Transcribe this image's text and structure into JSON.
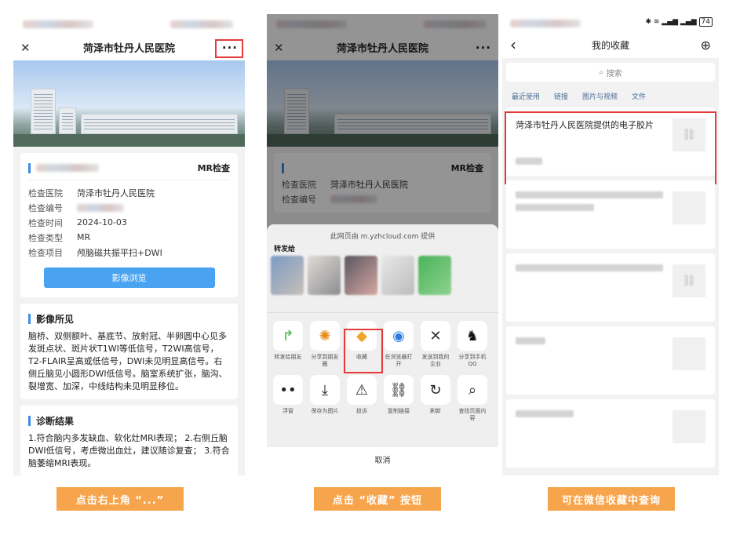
{
  "phone1": {
    "nav_close": "✕",
    "title": "菏泽市牡丹人民医院",
    "more": "···",
    "card_right": "MR检查",
    "rows": [
      {
        "k": "检查医院",
        "v": "菏泽市牡丹人民医院"
      },
      {
        "k": "检查编号",
        "v": ""
      },
      {
        "k": "检查时间",
        "v": "2024-10-03"
      },
      {
        "k": "检查类型",
        "v": "MR"
      },
      {
        "k": "检查项目",
        "v": "颅脑磁共振平扫+DWI"
      }
    ],
    "image_button": "影像浏览",
    "findings_title": "影像所见",
    "findings": "脑桥、双侧额叶、基底节、放射冠、半卵圆中心见多发斑点状、斑片状T1WI等低信号，T2WI高信号，T2-FLAIR呈高或低信号，DWI未见明显高信号。右侧丘脑见小圆形DWI低信号。脑室系统扩张，脑沟、裂增宽、加深，中线结构未见明显移位。",
    "diagnosis_title": "诊断结果",
    "diagnosis": "1.符合脑内多发缺血、软化灶MRI表现； 2.右侧丘脑DWI低信号，考虑微出血灶，建议随诊复查； 3.符合脑萎缩MRI表现。"
  },
  "phone2": {
    "title": "菏泽市牡丹人民医院",
    "card_right": "MR检查",
    "rows": [
      {
        "k": "检查医院",
        "v": "菏泽市牡丹人民医院"
      },
      {
        "k": "检查编号",
        "v": ""
      }
    ],
    "source": "此网页由 m.yzhcloud.com 提供",
    "forward_to": "转发给",
    "row1": [
      {
        "icon": "↱",
        "label": "转发给朋友"
      },
      {
        "icon": "✺",
        "label": "分享到朋友圈"
      },
      {
        "icon": "◆",
        "label": "收藏"
      },
      {
        "icon": "◉",
        "label": "在浏览器打开"
      },
      {
        "icon": "✕",
        "label": "发送到我的企业"
      },
      {
        "icon": "♞",
        "label": "分享到手机QQ"
      }
    ],
    "row2": [
      {
        "icon": "••",
        "label": "浮窗"
      },
      {
        "icon": "⤓",
        "label": "保存为图片"
      },
      {
        "icon": "⚠",
        "label": "投诉"
      },
      {
        "icon": "⛓",
        "label": "复制链接"
      },
      {
        "icon": "↻",
        "label": "刷新"
      },
      {
        "icon": "⌕",
        "label": "查找页面内容"
      }
    ],
    "cancel": "取消"
  },
  "phone3": {
    "battery": "74",
    "back": "‹",
    "title": "我的收藏",
    "add": "⊕",
    "search_placeholder": "搜索",
    "tabs": [
      "最近使用",
      "链接",
      "图片与视频",
      "文件"
    ],
    "first_fav": "菏泽市牡丹人民医院提供的电子胶片"
  },
  "captions": [
    "点击右上角 “...”",
    "点击 “收藏” 按钮",
    "可在微信收藏中查询"
  ],
  "colors": {
    "accent": "#4aa3f0",
    "highlight": "#e53a3a",
    "caption": "#f7a54c"
  }
}
